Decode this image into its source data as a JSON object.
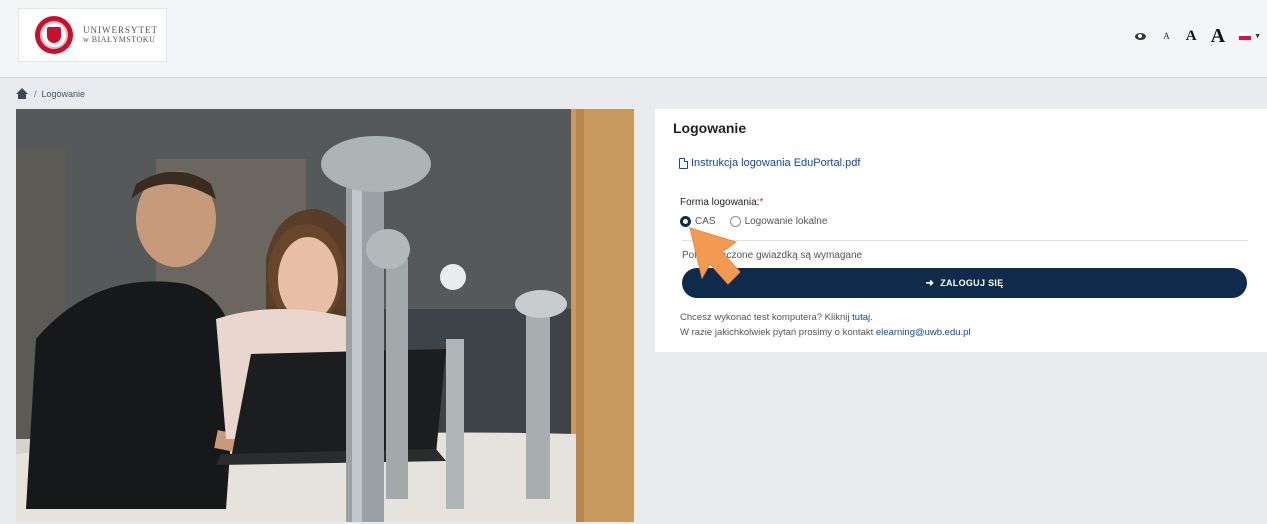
{
  "header": {
    "logo_line1": "UNIWERSYTET",
    "logo_line2": "w BIAŁYMSTOKU",
    "font_small": "A",
    "font_medium": "A",
    "font_large": "A",
    "eye_icon": "eye-icon",
    "flag_icon": "flag-poland-icon"
  },
  "breadcrumb": {
    "separator": "/",
    "current": "Logowanie"
  },
  "card": {
    "title": "Logowanie",
    "pdf_link": "Instrukcja logowania EduPortal.pdf",
    "form_label": "Forma logowania:",
    "required_mark": "*",
    "radio_options": [
      {
        "label": "CAS",
        "checked": true
      },
      {
        "label": "Logowanie lokalne",
        "checked": false
      }
    ],
    "required_note": "Pola oznaczone gwiazdką są wymagane",
    "login_button": "ZALOGUJ SIĘ",
    "test_text": "Chcesz wykonać test komputera? Kliknij",
    "test_link": "tutaj",
    "test_after": ".",
    "contact_text": "W razie jakichkolwiek pytań prosimy o kontakt",
    "contact_email": "elearning@uwb.edu.pl"
  },
  "colors": {
    "primary": "#0f2a4a",
    "link": "#0f47ad",
    "required": "#ca3120",
    "brand_red": "#c8102e",
    "pointer": "#f39a52"
  }
}
